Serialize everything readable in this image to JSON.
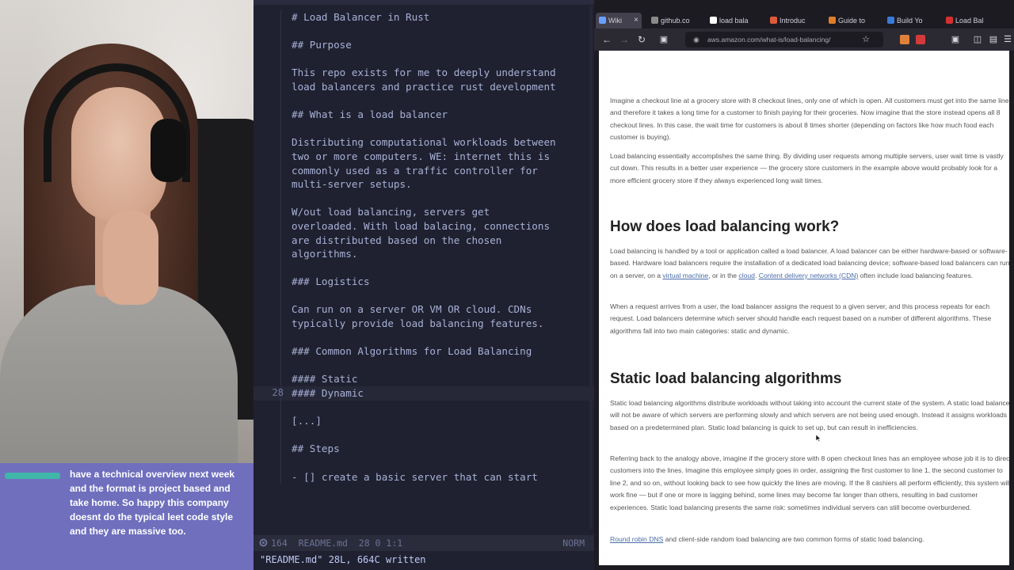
{
  "chat": {
    "message": "have a technical overview next week and the format is project based and take home. So happy this company doesnt do the typical leet code style and they are massive too."
  },
  "editor": {
    "lines": [
      {
        "num": "",
        "text": "# Load Balancer in Rust"
      },
      {
        "num": "",
        "text": ""
      },
      {
        "num": "",
        "text": "## Purpose"
      },
      {
        "num": "",
        "text": ""
      },
      {
        "num": "",
        "text": "This repo exists for me to deeply understand"
      },
      {
        "num": "",
        "text": "load balancers and practice rust development"
      },
      {
        "num": "",
        "text": ""
      },
      {
        "num": "",
        "text": "## What is a load balancer"
      },
      {
        "num": "",
        "text": ""
      },
      {
        "num": "",
        "text": "Distributing computational workloads between"
      },
      {
        "num": "",
        "text": "two or more computers. WE: internet this is"
      },
      {
        "num": "",
        "text": "commonly used as a traffic controller for"
      },
      {
        "num": "",
        "text": "multi-server setups."
      },
      {
        "num": "",
        "text": ""
      },
      {
        "num": "",
        "text": "W/out load balancing, servers get"
      },
      {
        "num": "",
        "text": "overloaded. With load balacing, connections"
      },
      {
        "num": "",
        "text": "are distributed based on the chosen"
      },
      {
        "num": "",
        "text": "algorithms."
      },
      {
        "num": "",
        "text": ""
      },
      {
        "num": "",
        "text": "### Logistics"
      },
      {
        "num": "",
        "text": ""
      },
      {
        "num": "",
        "text": "Can run on a server OR VM OR cloud. CDNs"
      },
      {
        "num": "",
        "text": "typically provide load balancing features."
      },
      {
        "num": "",
        "text": ""
      },
      {
        "num": "",
        "text": "### Common Algorithms for Load Balancing"
      },
      {
        "num": "",
        "text": ""
      },
      {
        "num": "",
        "text": "#### Static"
      },
      {
        "num": "28",
        "text": "#### Dynamic",
        "current": true
      },
      {
        "num": "",
        "text": ""
      },
      {
        "num": "",
        "text": "[...]"
      },
      {
        "num": "",
        "text": ""
      },
      {
        "num": "",
        "text": "## Steps"
      },
      {
        "num": "",
        "text": ""
      },
      {
        "num": "",
        "text": "- [] create a basic server that can start"
      }
    ],
    "status_left": "164  README.md  28 0 1:1",
    "status_right": "NORM",
    "command_line": "\"README.md\" 28L, 664C written"
  },
  "browser": {
    "tabs": [
      {
        "label": "Wiki",
        "active": true,
        "color": "#6aa0ff"
      },
      {
        "label": "github.co",
        "color": "#8a8a8a"
      },
      {
        "label": "load bala",
        "color": "#ffffff"
      },
      {
        "label": "Introduc",
        "color": "#e05a3a"
      },
      {
        "label": "Guide to",
        "color": "#e07d2a"
      },
      {
        "label": "Build Yo",
        "color": "#3a7ad9"
      },
      {
        "label": "Load Bal",
        "color": "#d33030"
      }
    ],
    "url": "aws.amazon.com/what-is/load-balancing/",
    "page": {
      "p1": "Imagine a checkout line at a grocery store with 8 checkout lines, only one of which is open. All customers must get into the same line, and therefore it takes a long time for a customer to finish paying for their groceries. Now imagine that the store instead opens all 8 checkout lines. In this case, the wait time for customers is about 8 times shorter (depending on factors like how much food each customer is buying).",
      "p2": "Load balancing essentially accomplishes the same thing. By dividing user requests among multiple servers, user wait time is vastly cut down. This results in a better user experience — the grocery store customers in the example above would probably look for a more efficient grocery store if they always experienced long wait times.",
      "h_how": "How does load balancing work?",
      "p3_a": "Load balancing is handled by a tool or application called a load balancer. A load balancer can be either hardware-based or software-based. Hardware load balancers require the installation of a dedicated load balancing device; software-based load balancers can run on a server, on a ",
      "p3_link1": "virtual machine",
      "p3_b": ", or in the ",
      "p3_link2": "cloud",
      "p3_c": ". ",
      "p3_link3": "Content delivery networks (CDN)",
      "p3_d": " often include load balancing features.",
      "p4": "When a request arrives from a user, the load balancer assigns the request to a given server, and this process repeats for each request. Load balancers determine which server should handle each request based on a number of different algorithms. These algorithms fall into two main categories: static and dynamic.",
      "h_static": "Static load balancing algorithms",
      "p5": "Static load balancing algorithms distribute workloads without taking into account the current state of the system. A static load balancer will not be aware of which servers are performing slowly and which servers are not being used enough. Instead it assigns workloads based on a predetermined plan. Static load balancing is quick to set up, but can result in inefficiencies.",
      "p6": "Referring back to the analogy above, imagine if the grocery store with 8 open checkout lines has an employee whose job it is to direct customers into the lines. Imagine this employee simply goes in order, assigning the first customer to line 1, the second customer to line 2, and so on, without looking back to see how quickly the lines are moving. If the 8 cashiers all perform efficiently, this system will work fine — but if one or more is lagging behind, some lines may become far longer than others, resulting in bad customer experiences. Static load balancing presents the same risk: sometimes individual servers can still become overburdened.",
      "p7_link": "Round robin DNS",
      "p7_rest": " and client-side random load balancing are two common forms of static load balancing."
    }
  }
}
